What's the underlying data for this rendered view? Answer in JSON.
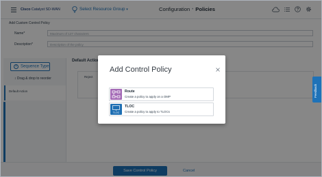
{
  "header": {
    "brand_bold": "Cisco",
    "brand_rest": "Catalyst SD-WAN",
    "resource_group": "Select Resource Group",
    "title": "Configuration",
    "subtitle": "Policies",
    "separator": "•",
    "icons": [
      "cloud-icon",
      "list-icon",
      "help-icon",
      "gear-icon"
    ]
  },
  "form": {
    "section_title": "Add Custom Control Policy",
    "name_label": "Name*",
    "name_placeholder": "Maximum of 127 characters",
    "description_label": "Description*",
    "description_placeholder": "Description of the policy"
  },
  "left_panel": {
    "sequence_button": "Sequence Type",
    "drag_hint": "Drag & drop to reorder",
    "default_action_item": "Default Action"
  },
  "main": {
    "default_action_heading": "Default Action",
    "reject_label": "Reject"
  },
  "footer": {
    "save_label": "Save Control Policy",
    "cancel_label": "Cancel"
  },
  "feedback_tab": "Feedback",
  "modal": {
    "title": "Add Control Policy",
    "options": [
      {
        "title": "Route",
        "description": "Create a policy to apply on a OMP",
        "icon": "route-icon",
        "color": "#a46ab6"
      },
      {
        "title": "TLOC",
        "description": "Create a policy to apply to TLOCs",
        "icon": "tloc-icon",
        "icon_text": "TLOC",
        "color": "#1e6fb3"
      }
    ]
  },
  "colors": {
    "accent": "#1e72b8",
    "brand": "#1c3d77"
  }
}
